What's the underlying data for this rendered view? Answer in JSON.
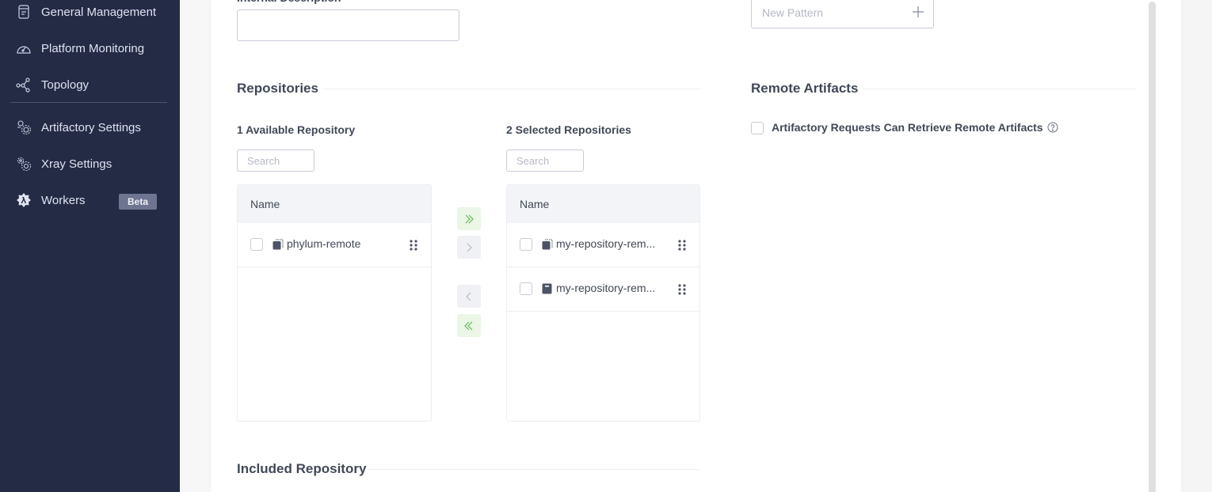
{
  "sidebar": {
    "items": [
      {
        "label": "General Management",
        "icon": "document-icon"
      },
      {
        "label": "Platform Monitoring",
        "icon": "gauge-icon"
      },
      {
        "label": "Topology",
        "icon": "topology-icon"
      },
      {
        "label": "Artifactory Settings",
        "icon": "artifactory-settings-icon"
      },
      {
        "label": "Xray Settings",
        "icon": "xray-settings-icon"
      },
      {
        "label": "Workers",
        "icon": "workers-icon",
        "badge": "Beta"
      }
    ]
  },
  "form": {
    "internal_description_label": "Internal Description",
    "internal_description_value": "",
    "new_pattern_placeholder": "New Pattern"
  },
  "repositories": {
    "section_title": "Repositories",
    "available": {
      "title": "1 Available Repository",
      "search_placeholder": "Search",
      "column_header": "Name",
      "rows": [
        {
          "name": "phylum-remote",
          "type": "remote"
        }
      ]
    },
    "selected": {
      "title": "2 Selected Repositories",
      "search_placeholder": "Search",
      "column_header": "Name",
      "rows": [
        {
          "name": "my-repository-rem...",
          "type": "remote"
        },
        {
          "name": "my-repository-rem...",
          "type": "local"
        }
      ]
    },
    "buttons": {
      "move_all_right": "»",
      "move_right": "›",
      "move_left": "‹",
      "move_all_left": "«"
    }
  },
  "remote_artifacts": {
    "section_title": "Remote Artifacts",
    "checkbox_label": "Artifactory Requests Can Retrieve Remote Artifacts",
    "checked": false
  },
  "included_repository": {
    "section_title": "Included Repository"
  },
  "colors": {
    "sidebar_bg": "#232b45",
    "accent_green": "#5cb85c",
    "text": "#414857"
  }
}
